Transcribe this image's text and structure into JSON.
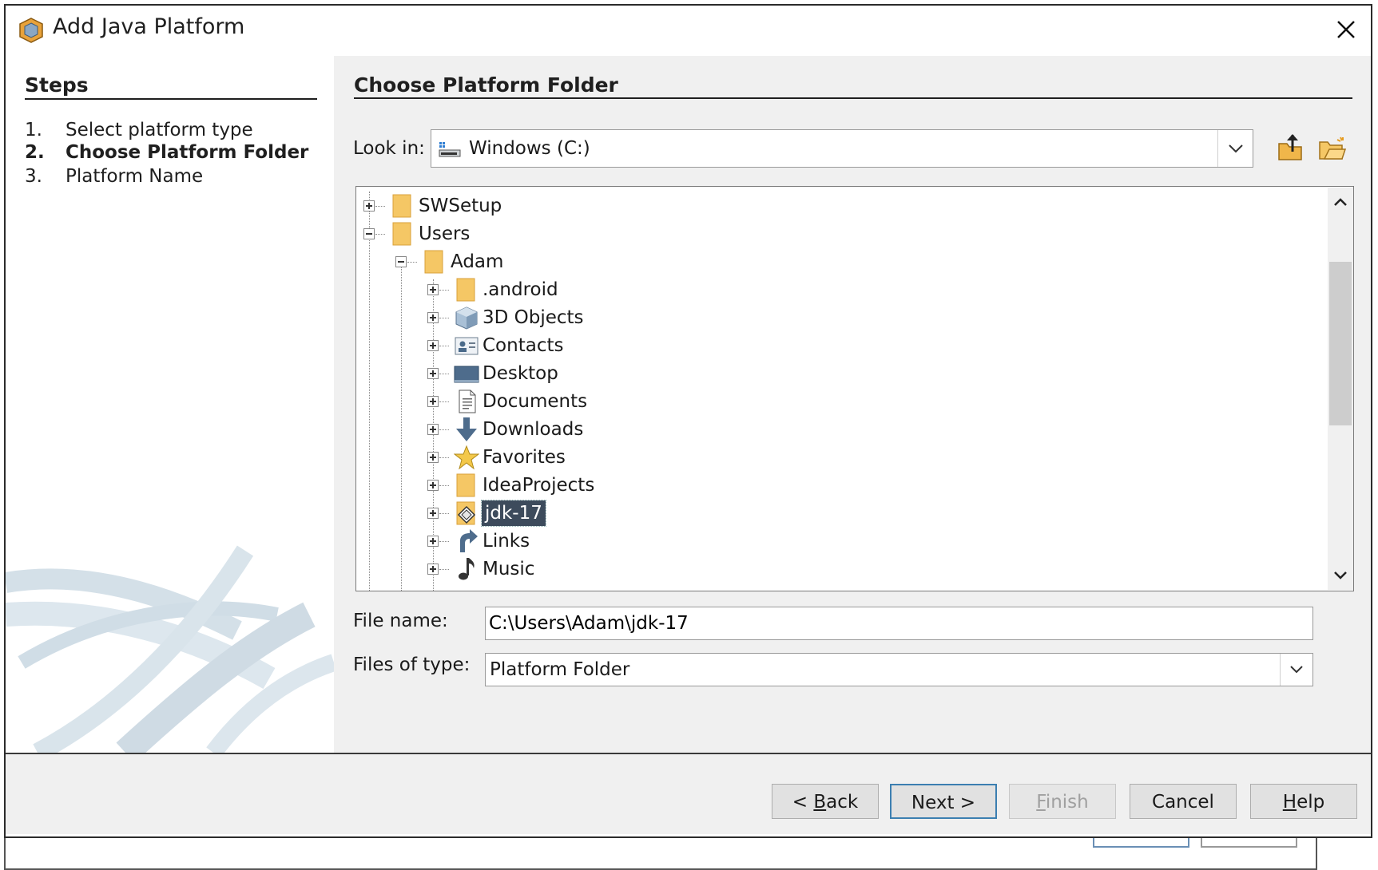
{
  "window": {
    "title": "Add Java Platform",
    "icons": {
      "app": "netbeans-cube-icon",
      "close": "close-icon"
    }
  },
  "steps": {
    "title": "Steps",
    "items": [
      {
        "num": "1.",
        "label": "Select platform type",
        "active": false
      },
      {
        "num": "2.",
        "label": "Choose Platform Folder",
        "active": true
      },
      {
        "num": "3.",
        "label": "Platform Name",
        "active": false
      }
    ]
  },
  "content": {
    "title": "Choose Platform Folder",
    "look_in": {
      "label": "Look in:",
      "value": "Windows (C:)",
      "icon": "drive-icon"
    },
    "toolbar": {
      "up_icon": "up-one-level-icon",
      "new_folder_icon": "new-folder-icon"
    },
    "tree": [
      {
        "name": "SWSetup",
        "icon": "folder-icon",
        "expanded": false
      },
      {
        "name": "Users",
        "icon": "folder-icon",
        "expanded": true
      },
      {
        "name": "Adam",
        "icon": "folder-icon",
        "expanded": true
      },
      {
        "name": ".android",
        "icon": "folder-icon",
        "expanded": false
      },
      {
        "name": "3D Objects",
        "icon": "3d-objects-icon",
        "expanded": false
      },
      {
        "name": "Contacts",
        "icon": "contacts-icon",
        "expanded": false
      },
      {
        "name": "Desktop",
        "icon": "desktop-icon",
        "expanded": false
      },
      {
        "name": "Documents",
        "icon": "documents-icon",
        "expanded": false
      },
      {
        "name": "Downloads",
        "icon": "downloads-icon",
        "expanded": false
      },
      {
        "name": "Favorites",
        "icon": "favorites-icon",
        "expanded": false
      },
      {
        "name": "IdeaProjects",
        "icon": "folder-icon",
        "expanded": false
      },
      {
        "name": "jdk-17",
        "icon": "java-platform-icon",
        "expanded": false,
        "selected": true
      },
      {
        "name": "Links",
        "icon": "links-icon",
        "expanded": false
      },
      {
        "name": "Music",
        "icon": "music-icon",
        "expanded": false
      }
    ],
    "file_name": {
      "label": "File name:",
      "value": "C:\\Users\\Adam\\jdk-17"
    },
    "files_of_type": {
      "label": "Files of type:",
      "value": "Platform Folder"
    }
  },
  "buttons": {
    "back": {
      "prefix": "< ",
      "mnemonic": "B",
      "rest": "ack"
    },
    "next": "Next >",
    "finish": {
      "mnemonic": "F",
      "rest": "inish"
    },
    "cancel": "Cancel",
    "help": {
      "mnemonic": "H",
      "rest": "elp"
    }
  },
  "colors": {
    "selection": "#3d4b5c",
    "default_button_border": "#3c7fb1",
    "folder": "#f5c765"
  }
}
